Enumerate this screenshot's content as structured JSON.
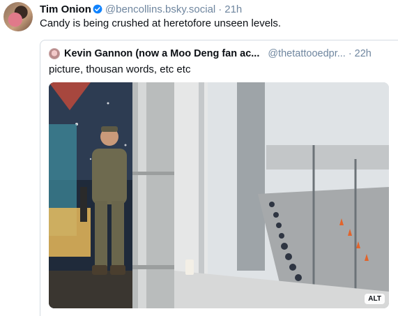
{
  "post": {
    "author_name": "Tim Onion",
    "author_handle": "@bencollins.bsky.social",
    "separator": "·",
    "time": "21h",
    "text": "Candy is being crushed at heretofore unseen levels."
  },
  "quote": {
    "author_name": "Kevin Gannon (now a Moo Deng fan ac...",
    "author_handle": "@thetattooedpr...",
    "separator": "·",
    "time": "22h",
    "text": "picture, thousan words, etc etc",
    "image_alt_badge": "ALT"
  },
  "icons": {
    "verified": "verified-check-icon"
  },
  "colors": {
    "verified": "#1083fe",
    "muted_text": "#6f869f",
    "border": "#d4dbe2"
  }
}
